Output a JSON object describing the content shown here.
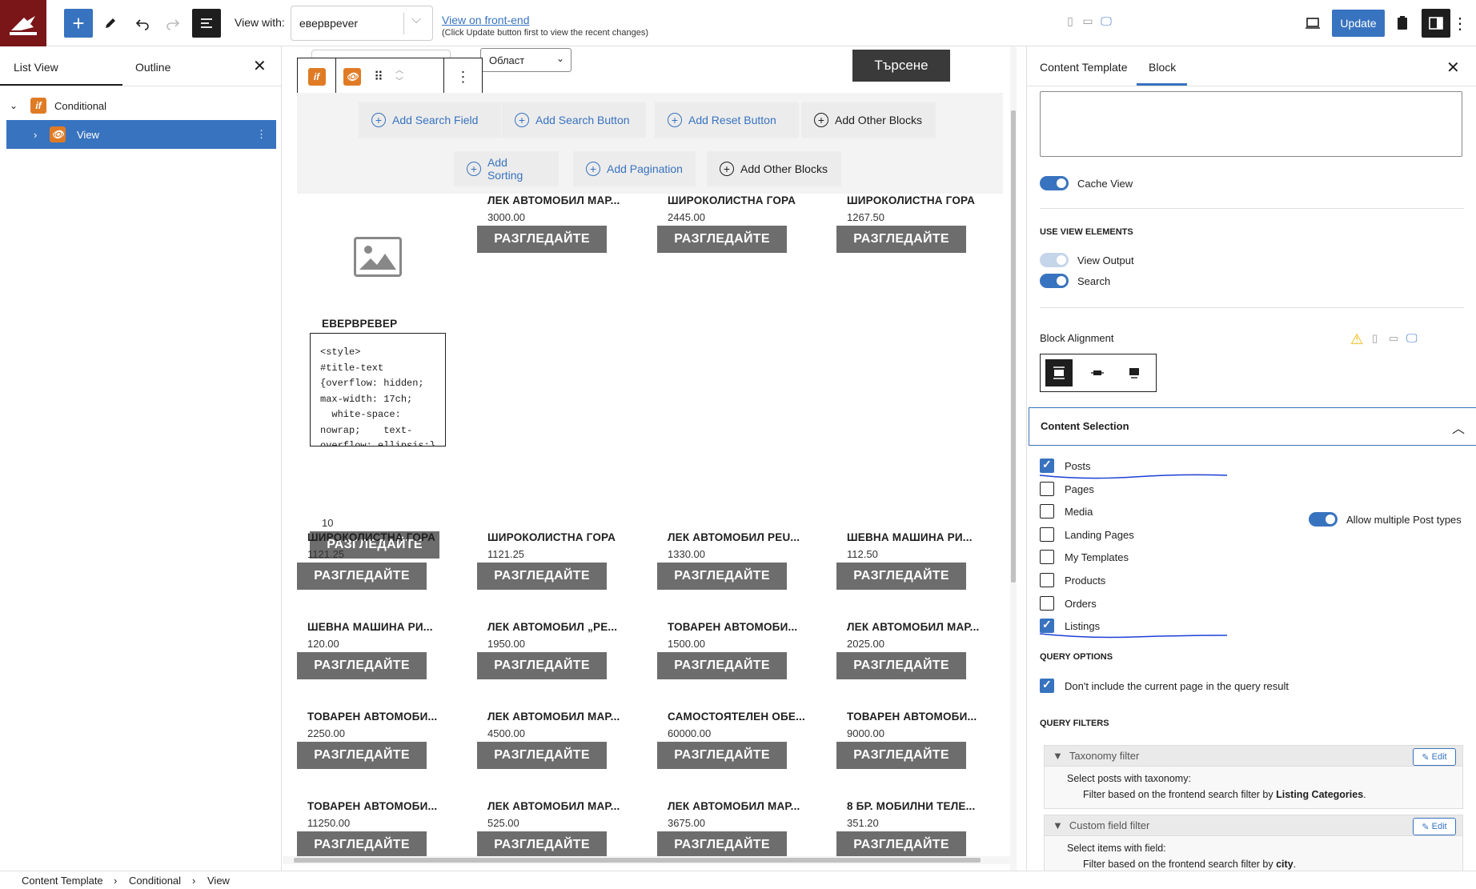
{
  "topbar": {
    "view_with_label": "View with:",
    "view_with_value": "еверврever",
    "view_on_frontend": "View on front-end",
    "update_note": "(Click Update button first to view the recent changes)",
    "update_label": "Update"
  },
  "left_panel": {
    "tab_list_view": "List View",
    "tab_outline": "Outline",
    "tree": [
      {
        "label": "Conditional"
      },
      {
        "label": "View"
      }
    ]
  },
  "canvas": {
    "region_select": "Област",
    "search_button": "Търсене",
    "row1_buttons": [
      "Add Search Field",
      "Add Search Button",
      "Add Reset Button",
      "Add Other Blocks"
    ],
    "row2_buttons": [
      "Add Sorting",
      "Add Pagination",
      "Add Other Blocks"
    ],
    "view_button_label": "РАЗГЛЕДАЙТЕ",
    "first_card": {
      "title": "ЕВЕРВРЕВЕР",
      "code": "<style>\n#title-text\n{overflow: hidden;\nmax-width: 17ch;\n  white-space:\nnowrap;    text-\noverflow: ellipsis;}",
      "price": "10"
    },
    "top_cards": [
      {
        "title": "ЛЕК АВТОМОБИЛ МАР...",
        "price": "3000.00"
      },
      {
        "title": "ШИРОКОЛИСТНА ГОРА",
        "price": "2445.00"
      },
      {
        "title": "ШИРОКОЛИСТНА ГОРА",
        "price": "1267.50"
      }
    ],
    "grid_rows": [
      [
        {
          "title": "ШИРОКОЛИСТНА ГОРА",
          "price": "1121.25"
        },
        {
          "title": "ШИРОКОЛИСТНА ГОРА",
          "price": "1121.25"
        },
        {
          "title": "ЛЕК АВТОМОБИЛ PEU...",
          "price": "1330.00"
        },
        {
          "title": "ШЕВНА МАШИНА РИ...",
          "price": "112.50"
        }
      ],
      [
        {
          "title": "ШЕВНА МАШИНА РИ...",
          "price": "120.00"
        },
        {
          "title": "ЛЕК АВТОМОБИЛ „РЕ...",
          "price": "1950.00"
        },
        {
          "title": "ТОВАРЕН АВТОМОБИ...",
          "price": "1500.00"
        },
        {
          "title": "ЛЕК АВТОМОБИЛ МАР...",
          "price": "2025.00"
        }
      ],
      [
        {
          "title": "ТОВАРЕН АВТОМОБИ...",
          "price": "2250.00"
        },
        {
          "title": "ЛЕК АВТОМОБИЛ МАР...",
          "price": "4500.00"
        },
        {
          "title": "САМОСТОЯТЕЛЕН ОБЕ...",
          "price": "60000.00"
        },
        {
          "title": "ТОВАРЕН АВТОМОБИ...",
          "price": "9000.00"
        }
      ],
      [
        {
          "title": "ТОВАРЕН АВТОМОБИ...",
          "price": "11250.00"
        },
        {
          "title": "ЛЕК АВТОМОБИЛ МАР...",
          "price": "525.00"
        },
        {
          "title": "ЛЕК АВТОМОБИЛ МАР...",
          "price": "3675.00"
        },
        {
          "title": "8 БР. МОБИЛНИ ТЕЛЕ...",
          "price": "351.20"
        }
      ]
    ]
  },
  "right_panel": {
    "tab_content_template": "Content Template",
    "tab_block": "Block",
    "cache_view": "Cache View",
    "use_view_elements": "USE VIEW ELEMENTS",
    "view_output": "View Output",
    "search": "Search",
    "block_alignment": "Block Alignment",
    "content_selection": "Content Selection",
    "allow_multiple": "Allow multiple Post types",
    "post_types": [
      {
        "label": "Posts",
        "checked": true
      },
      {
        "label": "Pages",
        "checked": false
      },
      {
        "label": "Media",
        "checked": false
      },
      {
        "label": "Landing Pages",
        "checked": false
      },
      {
        "label": "My Templates",
        "checked": false
      },
      {
        "label": "Products",
        "checked": false
      },
      {
        "label": "Orders",
        "checked": false
      },
      {
        "label": "Listings",
        "checked": true
      }
    ],
    "query_options": "QUERY OPTIONS",
    "dont_include": "Don't include the current page in the query result",
    "query_filters": "QUERY FILTERS",
    "taxonomy_filter": {
      "title": "Taxonomy filter",
      "edit": "Edit",
      "line1": "Select posts with taxonomy:",
      "line2_prefix": "Filter based on the frontend search filter by ",
      "line2_bold": "Listing Categories",
      "line2_suffix": "."
    },
    "custom_field_filter": {
      "title": "Custom field filter",
      "edit": "Edit",
      "line1": "Select items with field:",
      "line2_prefix": "Filter based on the frontend search filter by ",
      "line2_bold": "city",
      "line2_suffix": "."
    }
  },
  "breadcrumb": [
    "Content Template",
    "Conditional",
    "View"
  ],
  "colors": {
    "accent": "#3873bf",
    "button_gray": "#6d6d6d",
    "logo_bg": "#7a1518",
    "icon_orange": "#e07b25"
  }
}
